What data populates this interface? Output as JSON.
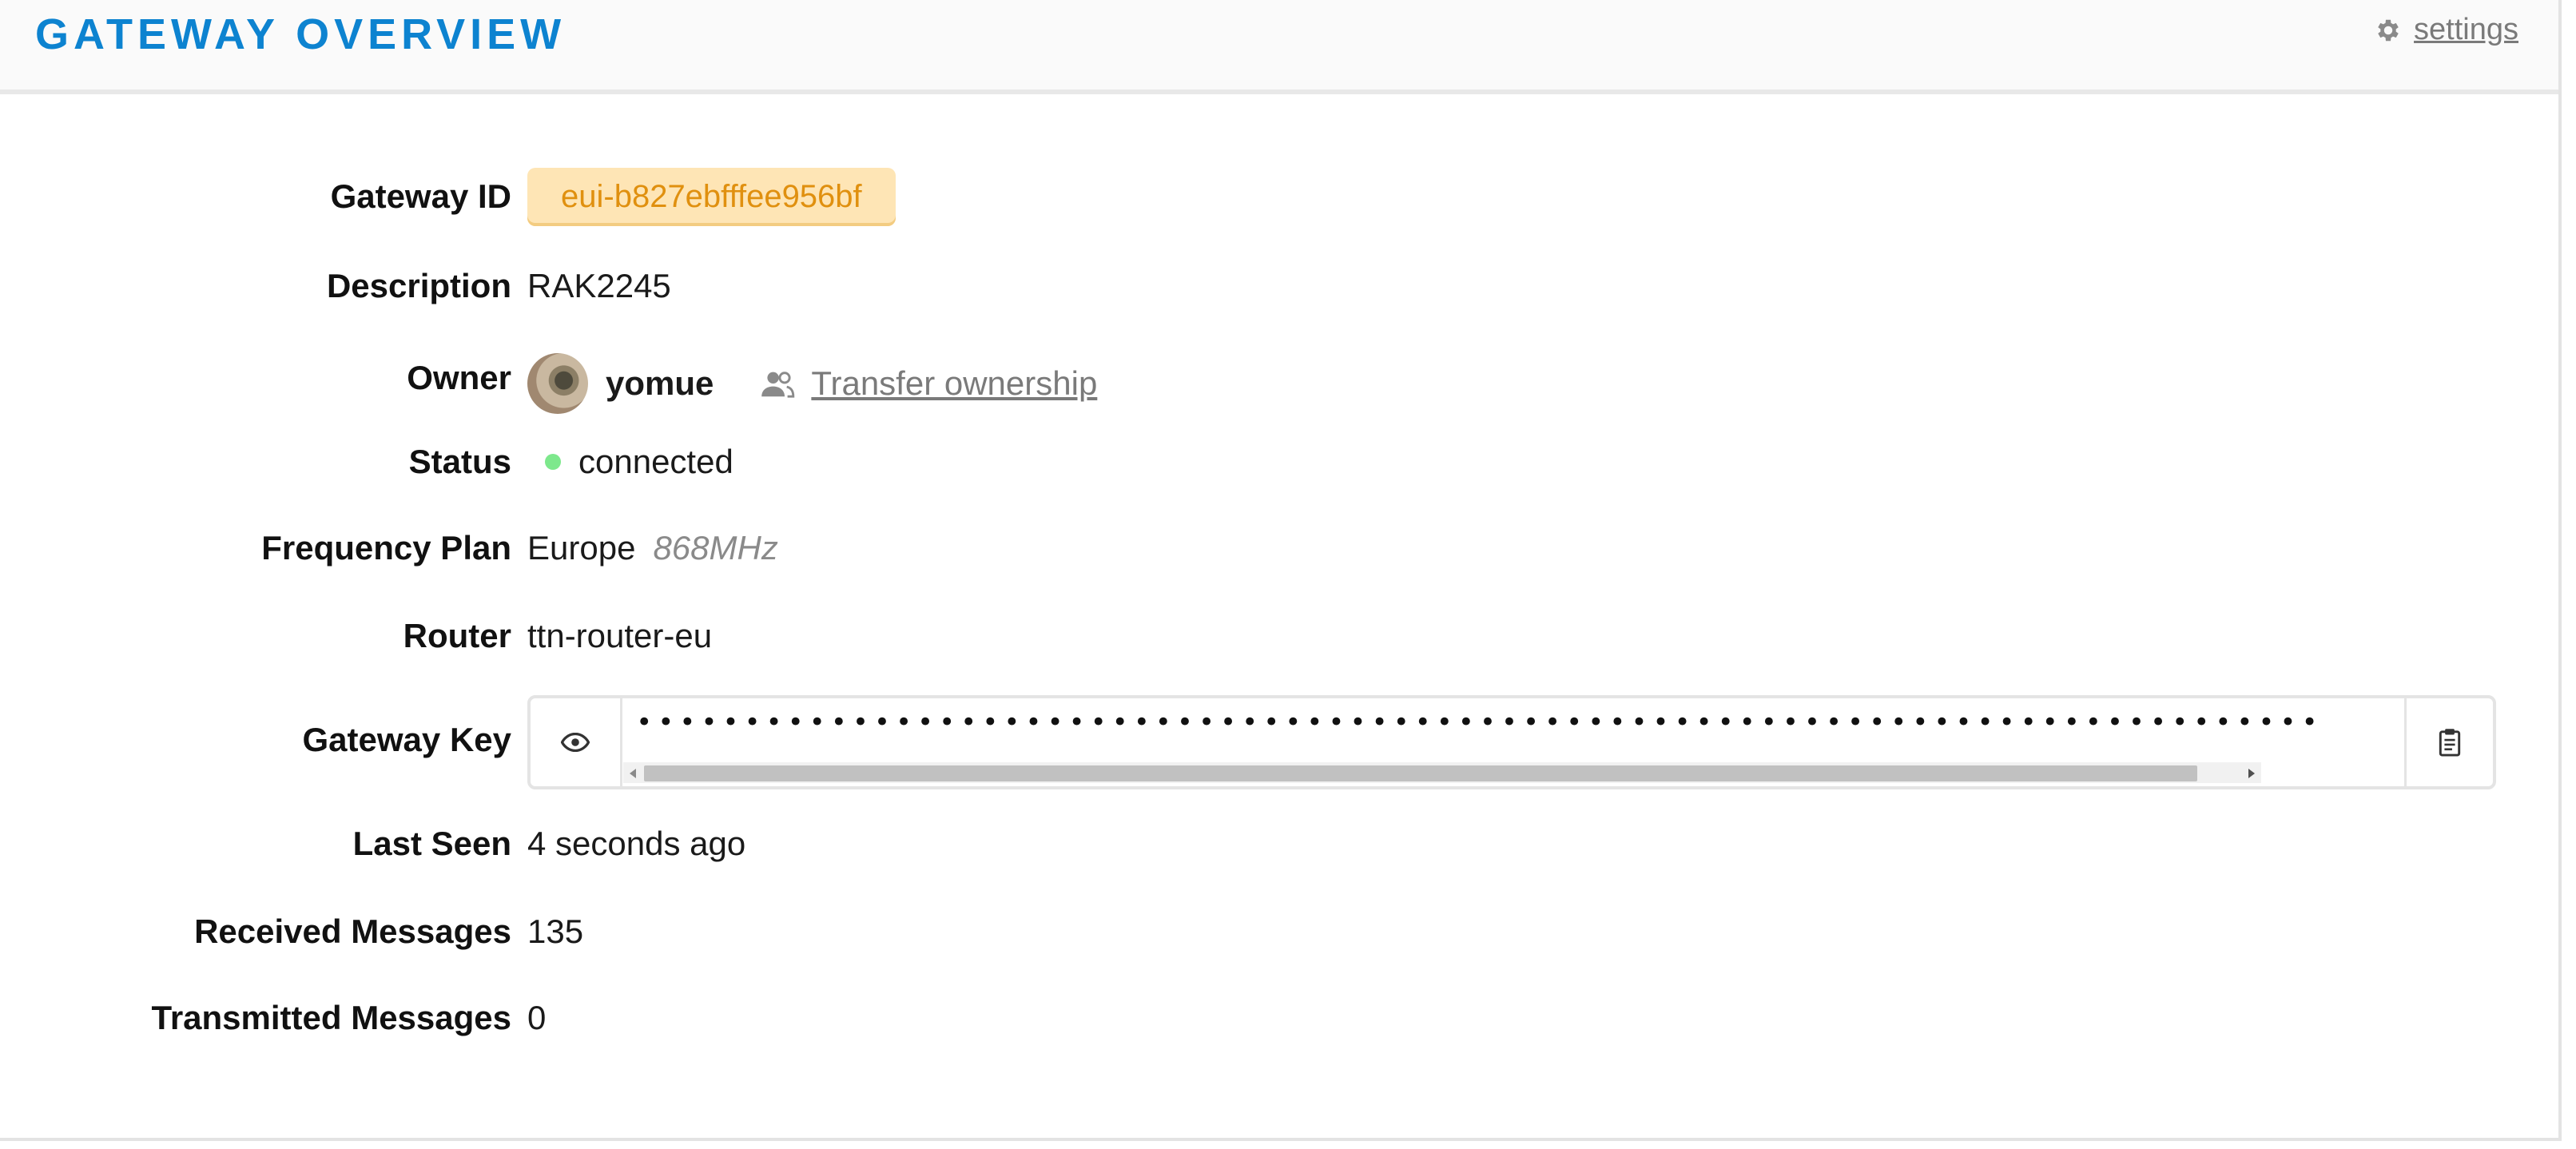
{
  "header": {
    "title": "Gateway Overview",
    "settings_label": "settings",
    "settings_icon": "gear-icon"
  },
  "fields": {
    "gateway_id": {
      "label": "Gateway ID",
      "value": "eui-b827ebfffee956bf"
    },
    "description": {
      "label": "Description",
      "value": "RAK2245"
    },
    "owner": {
      "label": "Owner",
      "name": "yomue",
      "transfer_label": "Transfer ownership",
      "transfer_icon": "users-icon"
    },
    "status": {
      "label": "Status",
      "value": "connected",
      "color": "#7de88c"
    },
    "frequency_plan": {
      "label": "Frequency Plan",
      "value": "Europe",
      "sub": "868MHz"
    },
    "router": {
      "label": "Router",
      "value": "ttn-router-eu"
    },
    "gateway_key": {
      "label": "Gateway Key",
      "masked": "••••••••••••••••••••••••••••••••••••••••••••••••••••••••••••••••••••••••••••••••••••••••••",
      "encoding": "base64",
      "reveal_icon": "eye-icon",
      "copy_icon": "clipboard-icon"
    },
    "last_seen": {
      "label": "Last Seen",
      "value": "4 seconds ago"
    },
    "received_messages": {
      "label": "Received Messages",
      "value": "135"
    },
    "transmitted_messages": {
      "label": "Transmitted Messages",
      "value": "0"
    }
  },
  "colors": {
    "accent": "#0d83d0",
    "badge_bg": "#fee5b5",
    "badge_text": "#e0900f"
  }
}
